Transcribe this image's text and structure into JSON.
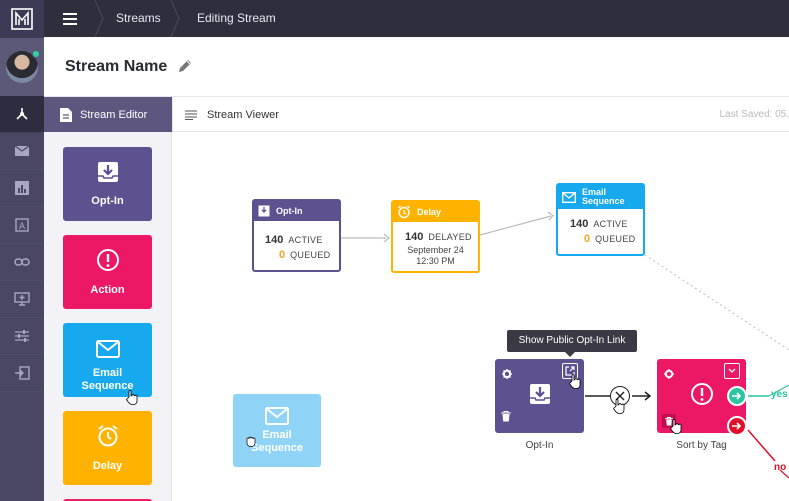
{
  "app": {
    "logo": "app-logo-icon"
  },
  "topbar": {
    "breadcrumbs": [
      "Streams",
      "Editing Stream"
    ]
  },
  "header": {
    "stream_name": "Stream Name"
  },
  "tabs": {
    "editor_label": "Stream Editor",
    "viewer_label": "Stream Viewer",
    "last_saved": "Last Saved: 05."
  },
  "sidebar": {
    "icons": [
      "streams-icon",
      "mail-icon",
      "chart-icon",
      "form-icon",
      "link-icon",
      "monitor-icon",
      "sliders-icon",
      "export-icon"
    ]
  },
  "palette": {
    "items": [
      {
        "label": "Opt-In",
        "color": "#5d5190"
      },
      {
        "label": "Action",
        "color": "#ec1765"
      },
      {
        "label": "Email\nSequence",
        "color": "#16a9ee"
      },
      {
        "label": "Delay",
        "color": "#ffb300"
      }
    ]
  },
  "canvas": {
    "optin_node": {
      "title": "Opt-In",
      "active_count": "140",
      "active_label": "ACTIVE",
      "queued_count": "0",
      "queued_label": "QUEUED",
      "color": "#5d5190"
    },
    "delay_node": {
      "title": "Delay",
      "count": "140",
      "label": "DELAYED",
      "date": "September 24",
      "time": "12:30 PM",
      "color": "#ffb300"
    },
    "email_node": {
      "title": "Email Sequence",
      "active_count": "140",
      "active_label": "ACTIVE",
      "queued_count": "0",
      "queued_label": "QUEUED",
      "color": "#16a9ee"
    },
    "tooltip": "Show Public Opt-In Link",
    "optin_tile_caption": "Opt-In",
    "sort_tile_caption": "Sort by Tag",
    "yes_label": "yes",
    "no_label": "no",
    "ghost_label": "Email\nSequence",
    "yes_color": "#2ec4a0",
    "no_color": "#e0102b"
  }
}
